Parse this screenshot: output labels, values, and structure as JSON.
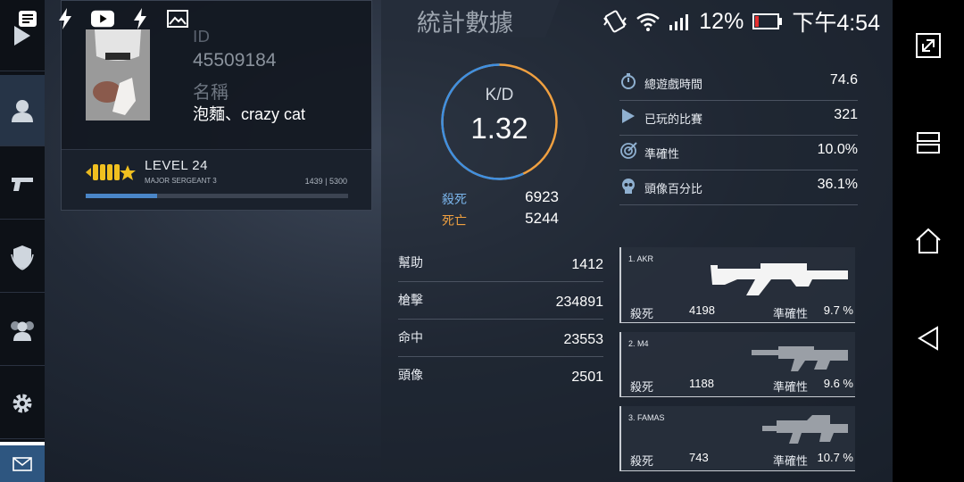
{
  "status_bar": {
    "battery": "12%",
    "time": "下午4:54",
    "icons": [
      "notification-icon",
      "bolt-icon",
      "youtube-icon",
      "bolt-icon",
      "image-icon",
      "vibrate-icon",
      "wifi-icon",
      "signal-icon",
      "battery-icon"
    ]
  },
  "colors": {
    "accent_blue": "#4a86c8",
    "kill": "#7ab4ea",
    "death": "#f0a040",
    "nav_active": "#263447",
    "mail": "#2e5680"
  },
  "profile": {
    "id_label": "ID",
    "id_value": "45509184",
    "name_label": "名稱",
    "name_value": "泡麵、crazy cat",
    "level": "LEVEL 24",
    "rank": "MAJOR SERGEANT 3",
    "xp": "1439 | 5300",
    "xp_fraction": 0.2715
  },
  "stats": {
    "title": "統計數據",
    "kd": {
      "label": "K/D",
      "value": "1.32",
      "kills_label": "殺死",
      "kills": "6923",
      "deaths_label": "死亡",
      "deaths": "5244",
      "kill_fraction": 0.569
    },
    "summary": [
      {
        "icon": "stopwatch-icon",
        "label": "總遊戲時間",
        "value": "74.6"
      },
      {
        "icon": "play-icon",
        "label": "已玩的比賽",
        "value": "321"
      },
      {
        "icon": "target-icon",
        "label": "準確性",
        "value": "10.0%"
      },
      {
        "icon": "skull-icon",
        "label": "頭像百分比",
        "value": "36.1%"
      }
    ],
    "details": [
      {
        "label": "幫助",
        "value": "1412"
      },
      {
        "label": "槍擊",
        "value": "234891"
      },
      {
        "label": "命中",
        "value": "23553"
      },
      {
        "label": "頭像",
        "value": "2501"
      }
    ],
    "weapons": [
      {
        "name": "1. AKR",
        "kills_label": "殺死",
        "kills": "4198",
        "acc_label": "準確性",
        "acc": "9.7 %"
      },
      {
        "name": "2. M4",
        "kills_label": "殺死",
        "kills": "1188",
        "acc_label": "準確性",
        "acc": "9.6 %"
      },
      {
        "name": "3. FAMAS",
        "kills_label": "殺死",
        "kills": "743",
        "acc_label": "準確性",
        "acc": "10.7 %"
      }
    ]
  }
}
